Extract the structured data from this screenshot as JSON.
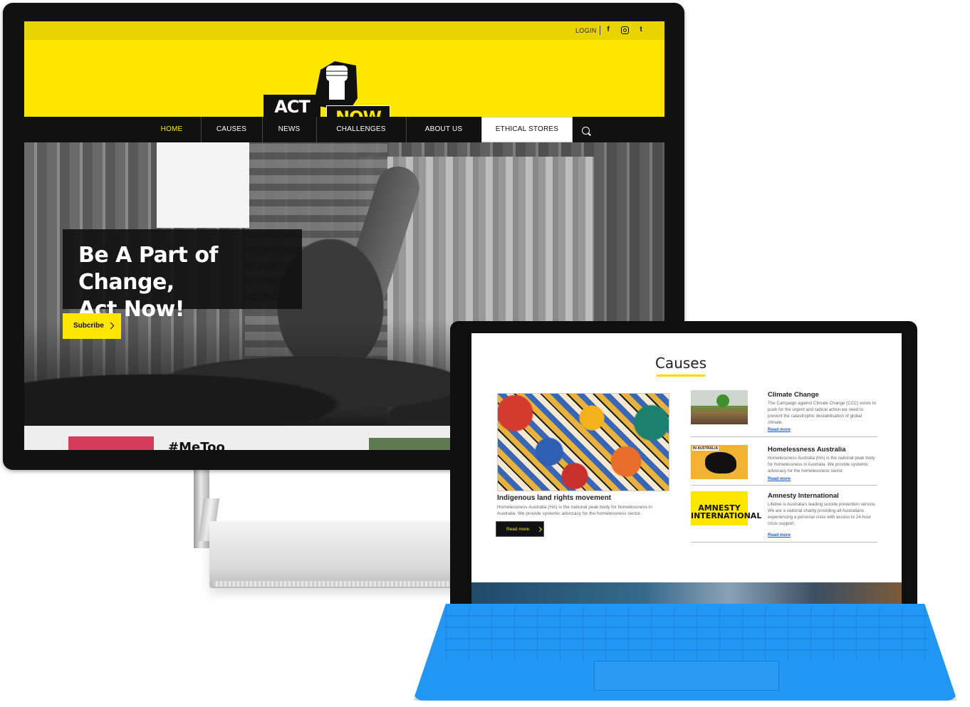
{
  "site": {
    "topbar": {
      "login": "LOGIN",
      "facebook": "f",
      "instagram": "",
      "twitter": "t"
    },
    "logo": {
      "word1": "ACT",
      "word2": "NOW"
    },
    "nav": [
      {
        "label": "HOME"
      },
      {
        "label": "CAUSES"
      },
      {
        "label": "NEWS"
      },
      {
        "label": "CHALLENGES"
      },
      {
        "label": "ABOUT US"
      },
      {
        "label": "ETHICAL STORES"
      }
    ],
    "hero": {
      "title_line1": "Be A Part of Change,",
      "title_line2": "Act Now!",
      "cta": "Subcribe"
    },
    "strip": {
      "heading": "#MeToo"
    },
    "colors": {
      "brand_yellow": "#ffe600",
      "dark": "#111111",
      "keyboard_blue": "#2196f3"
    }
  },
  "tablet": {
    "causes_heading": "Causes",
    "featured": {
      "title": "Indigenous land rights movement",
      "description": "Homelessness Australia (HA) is the national peak body for homelessness in Australia. We provide systemic advocacy for the homelessness sector.",
      "button": "Read more"
    },
    "causes": [
      {
        "title": "Climate Change",
        "description": "The Campaign against Climate Change (CCC) exists to push for the urgent and radical action we need to prevent the catastrophic destabilisation of global climate.",
        "link": "Read more",
        "icon": "tree-image"
      },
      {
        "title": "Homelessness Australia",
        "description": "Homelessness Australia (HA) is the national peak body for homelessness in Australia. We provide systemic advocacy for the homelessness sector.",
        "link": "Read more",
        "thumb_tag": "IN AUSTRALIA",
        "icon": "australia-map-image"
      },
      {
        "title": "Amnesty International",
        "description": "Lifeline is Australia's leading suicide prevention service. We are a national charity providing all Australians experiencing a personal crisis with access to 24-hour crisis support.",
        "link": "Read more",
        "logo_text": "AMNESTY INTERNATIONAL",
        "icon": "amnesty-logo"
      }
    ]
  }
}
